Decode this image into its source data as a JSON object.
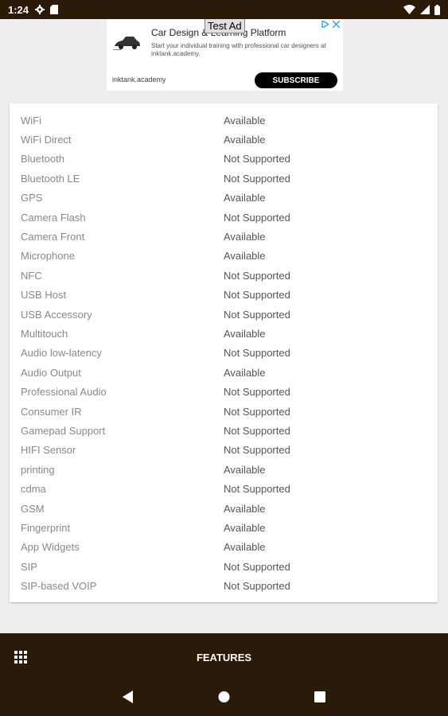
{
  "status_bar": {
    "time": "1:24"
  },
  "ad": {
    "badge": "Test Ad",
    "title": "Car Design & Learning Platform",
    "description": "Start your individual training with professional car designers at inktank.academy.",
    "domain": "inktank.academy",
    "cta": "SUBSCRIBE"
  },
  "features": [
    {
      "name": "WiFi",
      "status": "Available"
    },
    {
      "name": "WiFi Direct",
      "status": "Available"
    },
    {
      "name": "Bluetooth",
      "status": "Not Supported"
    },
    {
      "name": "Bluetooth LE",
      "status": "Not Supported"
    },
    {
      "name": "GPS",
      "status": "Available"
    },
    {
      "name": "Camera Flash",
      "status": "Not Supported"
    },
    {
      "name": "Camera Front",
      "status": "Available"
    },
    {
      "name": "Microphone",
      "status": "Available"
    },
    {
      "name": "NFC",
      "status": "Not Supported"
    },
    {
      "name": "USB Host",
      "status": "Not Supported"
    },
    {
      "name": "USB Accessory",
      "status": "Not Supported"
    },
    {
      "name": "Multitouch",
      "status": "Available"
    },
    {
      "name": "Audio low-latency",
      "status": "Not Supported"
    },
    {
      "name": "Audio Output",
      "status": "Available"
    },
    {
      "name": "Professional Audio",
      "status": "Not Supported"
    },
    {
      "name": "Consumer IR",
      "status": "Not Supported"
    },
    {
      "name": "Gamepad Support",
      "status": "Not Supported"
    },
    {
      "name": "HIFI Sensor",
      "status": "Not Supported"
    },
    {
      "name": "printing",
      "status": "Available"
    },
    {
      "name": "cdma",
      "status": "Not Supported"
    },
    {
      "name": "GSM",
      "status": "Available"
    },
    {
      "name": "Fingerprint",
      "status": "Available"
    },
    {
      "name": "App Widgets",
      "status": "Available"
    },
    {
      "name": "SIP",
      "status": "Not Supported"
    },
    {
      "name": "SIP-based VOIP",
      "status": "Not Supported"
    }
  ],
  "bottom_bar": {
    "title": "FEATURES"
  },
  "colors": {
    "bar_background": "#2c1a08",
    "page_background": "#eeeeee"
  }
}
